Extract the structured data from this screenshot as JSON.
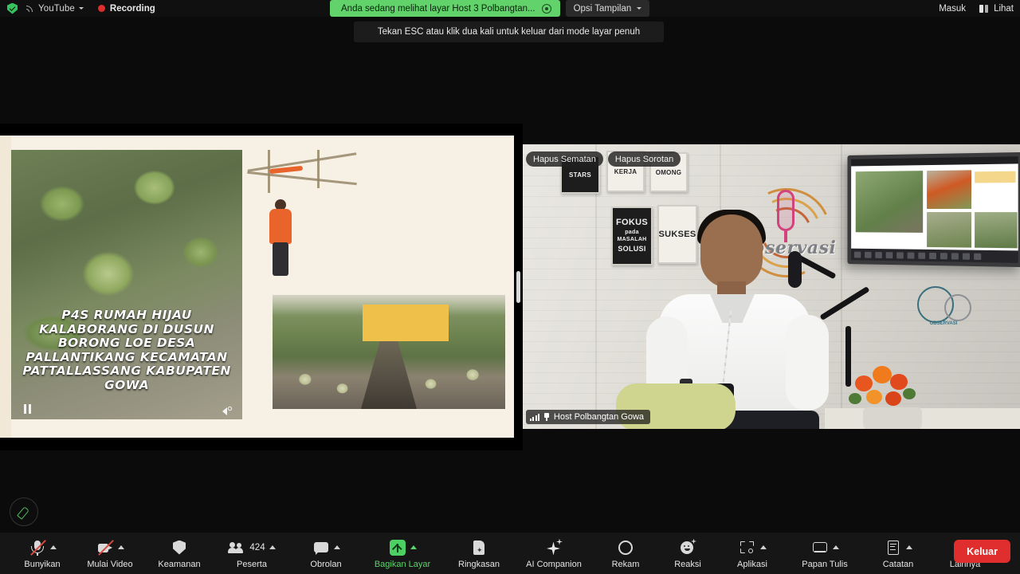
{
  "topbar": {
    "security_icon": "shield-check-icon",
    "stream_icon": "rss-icon",
    "stream_label": "YouTube",
    "stream_chevron": "chevron-down-icon",
    "recording_label": "Recording",
    "recording_dot": "record-dot-icon",
    "share_banner": "Anda sedang melihat layar Host 3 Polbangtan...",
    "stop_share_icon": "stop-share-icon",
    "view_options_label": "Opsi Tampilan",
    "view_options_chevron": "chevron-down-icon",
    "signin_label": "Masuk",
    "view_label": "Lihat",
    "view_icon": "layout-view-icon",
    "accent_green": "#62d36b"
  },
  "tooltip": {
    "text": "Tekan ESC atau klik dua kali untuk keluar dari mode layar penuh"
  },
  "shared_screen": {
    "slide_bg": "#f7f0e4",
    "gold_block": "#efc04a",
    "video_caption": "P4S RUMAH HIJAU KALABORANG DI DUSUN BORONG LOE DESA PALLANTIKANG KECAMATAN PATTALLASSANG KABUPATEN GOWA",
    "pause_icon": "pause-icon",
    "speaker_icon": "speaker-icon",
    "photos": [
      {
        "name": "greenhouse-melon-video"
      },
      {
        "name": "farmer-tending-plants-photo"
      },
      {
        "name": "greenhouse-rows-photo"
      }
    ]
  },
  "video_panel": {
    "unpin_label": "Hapus Sematan",
    "unspotlight_label": "Hapus Sorotan",
    "participant_name": "Host Polbangtan Gowa",
    "signal_icon": "signal-bars-icon",
    "pin_icon": "pin-icon",
    "studio_logo_text": "Observasi",
    "posters": [
      {
        "line1": "STARS"
      },
      {
        "line1": "KERJA"
      },
      {
        "line1": "OMONG"
      },
      {
        "line1": "FOKUS",
        "line2": "pada MASALAH",
        "line3": "SOLUSI"
      },
      {
        "line1": "SUKSES"
      }
    ],
    "plaque_text": "OBSERVASI"
  },
  "annotate": {
    "icon": "pencil-annotate-icon"
  },
  "toolbar": {
    "items": [
      {
        "name": "unmute-button",
        "icon": "microphone-muted-icon",
        "label": "Bunyikan",
        "chevron": true,
        "active": false
      },
      {
        "name": "start-video-button",
        "icon": "camera-muted-icon",
        "label": "Mulai Video",
        "chevron": true,
        "active": false
      },
      {
        "name": "security-button",
        "icon": "shield-icon",
        "label": "Keamanan",
        "chevron": false,
        "active": false
      },
      {
        "name": "participants-button",
        "icon": "people-icon",
        "label": "Peserta",
        "count": "424",
        "chevron": true,
        "active": false
      },
      {
        "name": "chat-button",
        "icon": "chat-bubble-icon",
        "label": "Obrolan",
        "chevron": true,
        "active": false
      },
      {
        "name": "share-screen-button",
        "icon": "share-screen-icon",
        "label": "Bagikan Layar",
        "chevron": true,
        "active": true
      },
      {
        "name": "summary-button",
        "icon": "summary-doc-icon",
        "label": "Ringkasan",
        "chevron": false,
        "active": false
      },
      {
        "name": "ai-companion-button",
        "icon": "sparkle-icon",
        "label": "AI Companion",
        "chevron": false,
        "active": false
      },
      {
        "name": "record-button",
        "icon": "record-circle-icon",
        "label": "Rekam",
        "chevron": false,
        "active": false
      },
      {
        "name": "reactions-button",
        "icon": "smiley-reaction-icon",
        "label": "Reaksi",
        "chevron": false,
        "active": false
      },
      {
        "name": "apps-button",
        "icon": "apps-icon",
        "label": "Aplikasi",
        "chevron": true,
        "active": false
      },
      {
        "name": "whiteboard-button",
        "icon": "whiteboard-icon",
        "label": "Papan Tulis",
        "chevron": true,
        "active": false
      },
      {
        "name": "notes-button",
        "icon": "notes-icon",
        "label": "Catatan",
        "chevron": true,
        "active": false
      },
      {
        "name": "more-button",
        "icon": "ellipsis-icon",
        "label": "Lainnya",
        "chevron": false,
        "active": false
      }
    ],
    "leave_label": "Keluar",
    "leave_color": "#e02d2d"
  }
}
